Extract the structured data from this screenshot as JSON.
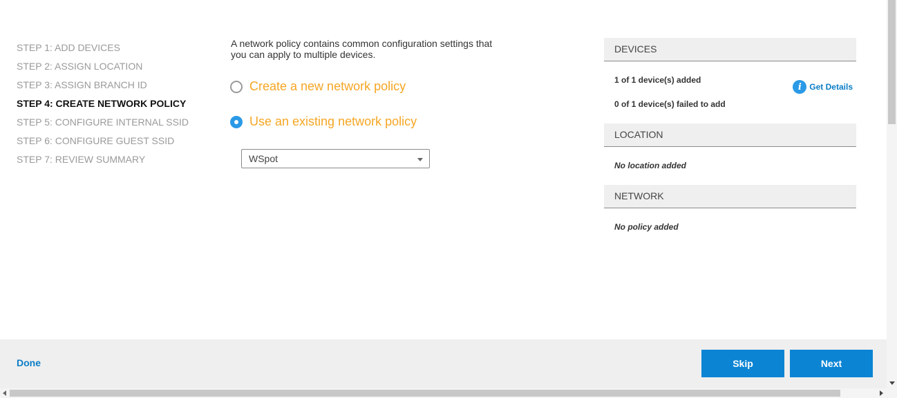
{
  "steps": [
    {
      "label": "STEP 1: ADD DEVICES"
    },
    {
      "label": "STEP 2: ASSIGN LOCATION"
    },
    {
      "label": "STEP 3: ASSIGN BRANCH ID"
    },
    {
      "label": "STEP 4: CREATE NETWORK POLICY"
    },
    {
      "label": "STEP 5: CONFIGURE INTERNAL SSID"
    },
    {
      "label": "STEP 6: CONFIGURE GUEST SSID"
    },
    {
      "label": "STEP 7: REVIEW SUMMARY"
    }
  ],
  "policy": {
    "intro": "A network policy contains common configuration settings that you can apply to multiple devices.",
    "option_new": "Create a new network policy",
    "option_existing": "Use an existing network policy",
    "selected_option": "existing",
    "select_value": "WSpot"
  },
  "summary": {
    "devices": {
      "title": "DEVICES",
      "added": "1 of 1 device(s) added",
      "failed": "0 of 1 device(s) failed to add",
      "get_details": "Get Details",
      "info_icon_glyph": "i"
    },
    "location": {
      "title": "LOCATION",
      "text": "No location added"
    },
    "network": {
      "title": "NETWORK",
      "text": "No policy added"
    }
  },
  "footer": {
    "done": "Done",
    "skip": "Skip",
    "next": "Next"
  },
  "colors": {
    "accent": "#0b84d4",
    "radio_label": "#f5a623",
    "radio_checked": "#2b9ae6"
  }
}
